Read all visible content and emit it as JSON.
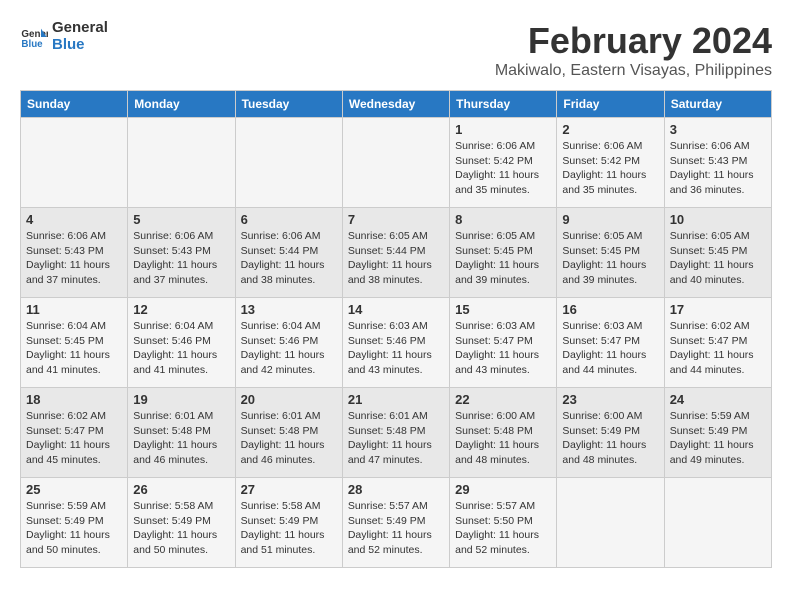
{
  "logo": {
    "line1": "General",
    "line2": "Blue"
  },
  "title": "February 2024",
  "location": "Makiwalo, Eastern Visayas, Philippines",
  "days_of_week": [
    "Sunday",
    "Monday",
    "Tuesday",
    "Wednesday",
    "Thursday",
    "Friday",
    "Saturday"
  ],
  "weeks": [
    [
      {
        "day": "",
        "detail": ""
      },
      {
        "day": "",
        "detail": ""
      },
      {
        "day": "",
        "detail": ""
      },
      {
        "day": "",
        "detail": ""
      },
      {
        "day": "1",
        "detail": "Sunrise: 6:06 AM\nSunset: 5:42 PM\nDaylight: 11 hours\nand 35 minutes."
      },
      {
        "day": "2",
        "detail": "Sunrise: 6:06 AM\nSunset: 5:42 PM\nDaylight: 11 hours\nand 35 minutes."
      },
      {
        "day": "3",
        "detail": "Sunrise: 6:06 AM\nSunset: 5:43 PM\nDaylight: 11 hours\nand 36 minutes."
      }
    ],
    [
      {
        "day": "4",
        "detail": "Sunrise: 6:06 AM\nSunset: 5:43 PM\nDaylight: 11 hours\nand 37 minutes."
      },
      {
        "day": "5",
        "detail": "Sunrise: 6:06 AM\nSunset: 5:43 PM\nDaylight: 11 hours\nand 37 minutes."
      },
      {
        "day": "6",
        "detail": "Sunrise: 6:06 AM\nSunset: 5:44 PM\nDaylight: 11 hours\nand 38 minutes."
      },
      {
        "day": "7",
        "detail": "Sunrise: 6:05 AM\nSunset: 5:44 PM\nDaylight: 11 hours\nand 38 minutes."
      },
      {
        "day": "8",
        "detail": "Sunrise: 6:05 AM\nSunset: 5:45 PM\nDaylight: 11 hours\nand 39 minutes."
      },
      {
        "day": "9",
        "detail": "Sunrise: 6:05 AM\nSunset: 5:45 PM\nDaylight: 11 hours\nand 39 minutes."
      },
      {
        "day": "10",
        "detail": "Sunrise: 6:05 AM\nSunset: 5:45 PM\nDaylight: 11 hours\nand 40 minutes."
      }
    ],
    [
      {
        "day": "11",
        "detail": "Sunrise: 6:04 AM\nSunset: 5:45 PM\nDaylight: 11 hours\nand 41 minutes."
      },
      {
        "day": "12",
        "detail": "Sunrise: 6:04 AM\nSunset: 5:46 PM\nDaylight: 11 hours\nand 41 minutes."
      },
      {
        "day": "13",
        "detail": "Sunrise: 6:04 AM\nSunset: 5:46 PM\nDaylight: 11 hours\nand 42 minutes."
      },
      {
        "day": "14",
        "detail": "Sunrise: 6:03 AM\nSunset: 5:46 PM\nDaylight: 11 hours\nand 43 minutes."
      },
      {
        "day": "15",
        "detail": "Sunrise: 6:03 AM\nSunset: 5:47 PM\nDaylight: 11 hours\nand 43 minutes."
      },
      {
        "day": "16",
        "detail": "Sunrise: 6:03 AM\nSunset: 5:47 PM\nDaylight: 11 hours\nand 44 minutes."
      },
      {
        "day": "17",
        "detail": "Sunrise: 6:02 AM\nSunset: 5:47 PM\nDaylight: 11 hours\nand 44 minutes."
      }
    ],
    [
      {
        "day": "18",
        "detail": "Sunrise: 6:02 AM\nSunset: 5:47 PM\nDaylight: 11 hours\nand 45 minutes."
      },
      {
        "day": "19",
        "detail": "Sunrise: 6:01 AM\nSunset: 5:48 PM\nDaylight: 11 hours\nand 46 minutes."
      },
      {
        "day": "20",
        "detail": "Sunrise: 6:01 AM\nSunset: 5:48 PM\nDaylight: 11 hours\nand 46 minutes."
      },
      {
        "day": "21",
        "detail": "Sunrise: 6:01 AM\nSunset: 5:48 PM\nDaylight: 11 hours\nand 47 minutes."
      },
      {
        "day": "22",
        "detail": "Sunrise: 6:00 AM\nSunset: 5:48 PM\nDaylight: 11 hours\nand 48 minutes."
      },
      {
        "day": "23",
        "detail": "Sunrise: 6:00 AM\nSunset: 5:49 PM\nDaylight: 11 hours\nand 48 minutes."
      },
      {
        "day": "24",
        "detail": "Sunrise: 5:59 AM\nSunset: 5:49 PM\nDaylight: 11 hours\nand 49 minutes."
      }
    ],
    [
      {
        "day": "25",
        "detail": "Sunrise: 5:59 AM\nSunset: 5:49 PM\nDaylight: 11 hours\nand 50 minutes."
      },
      {
        "day": "26",
        "detail": "Sunrise: 5:58 AM\nSunset: 5:49 PM\nDaylight: 11 hours\nand 50 minutes."
      },
      {
        "day": "27",
        "detail": "Sunrise: 5:58 AM\nSunset: 5:49 PM\nDaylight: 11 hours\nand 51 minutes."
      },
      {
        "day": "28",
        "detail": "Sunrise: 5:57 AM\nSunset: 5:49 PM\nDaylight: 11 hours\nand 52 minutes."
      },
      {
        "day": "29",
        "detail": "Sunrise: 5:57 AM\nSunset: 5:50 PM\nDaylight: 11 hours\nand 52 minutes."
      },
      {
        "day": "",
        "detail": ""
      },
      {
        "day": "",
        "detail": ""
      }
    ]
  ]
}
